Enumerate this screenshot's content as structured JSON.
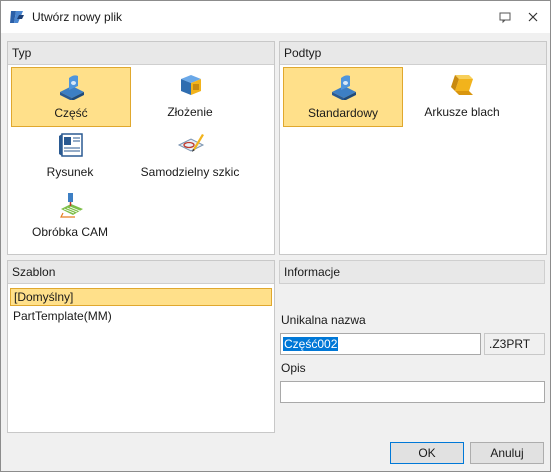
{
  "window": {
    "title": "Utwórz nowy plik"
  },
  "type_panel": {
    "header": "Typ",
    "items": [
      {
        "label": "Część",
        "icon": "part-icon",
        "selected": true
      },
      {
        "label": "Złożenie",
        "icon": "assembly-icon",
        "selected": false
      },
      {
        "label": "Rysunek",
        "icon": "drawing-icon",
        "selected": false
      },
      {
        "label": "Samodzielny szkic",
        "icon": "sketch-icon",
        "selected": false
      },
      {
        "label": "Obróbka CAM",
        "icon": "cam-icon",
        "selected": false
      }
    ]
  },
  "subtype_panel": {
    "header": "Podtyp",
    "items": [
      {
        "label": "Standardowy",
        "icon": "standard-part-icon",
        "selected": true
      },
      {
        "label": "Arkusze blach",
        "icon": "sheet-metal-icon",
        "selected": false
      }
    ]
  },
  "template_panel": {
    "header": "Szablon",
    "items": [
      {
        "label": "[Domyślny]",
        "selected": true
      },
      {
        "label": "PartTemplate(MM)",
        "selected": false
      }
    ]
  },
  "info_panel": {
    "header": "Informacje",
    "unique_name_label": "Unikalna nazwa",
    "unique_name_value": "Część002",
    "extension": ".Z3PRT",
    "description_label": "Opis",
    "description_value": ""
  },
  "buttons": {
    "ok": "OK",
    "cancel": "Anuluj"
  },
  "colors": {
    "selection_fill": "#ffe08a",
    "selection_border": "#e0a82e",
    "text_selection": "#0078d7"
  }
}
